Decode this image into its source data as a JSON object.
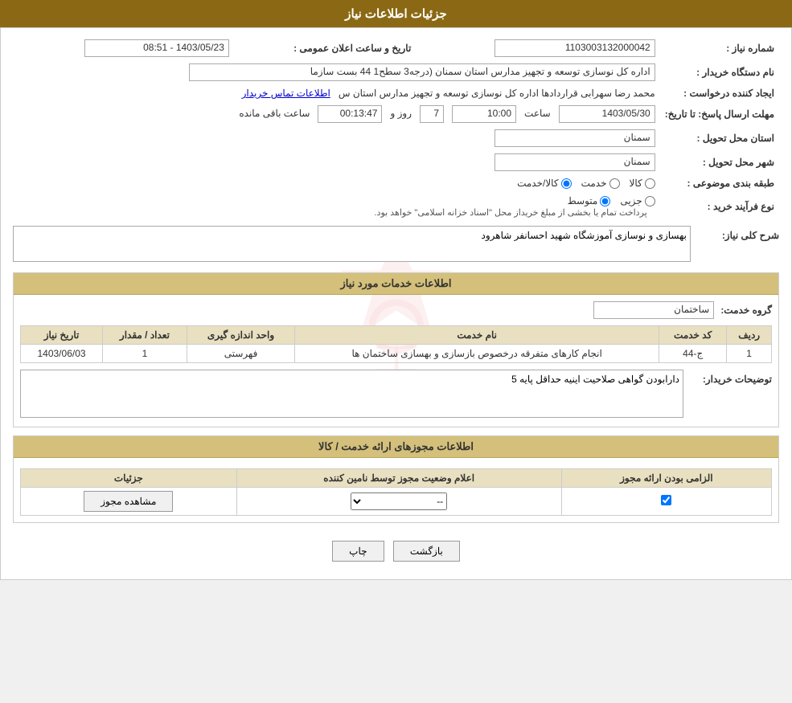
{
  "header": {
    "title": "جزئیات اطلاعات نیاز"
  },
  "main_info": {
    "labels": {
      "need_number": "شماره نیاز :",
      "buyer_name": "نام دستگاه خریدار :",
      "creator": "ایجاد کننده درخواست :",
      "deadline": "مهلت ارسال پاسخ: تا تاریخ:",
      "province": "استان محل تحویل :",
      "city": "شهر محل تحویل :",
      "category": "طبقه بندی موضوعی :",
      "purchase_type": "نوع فرآیند خرید :"
    },
    "need_number": "1103003132000042",
    "announce_label": "تاریخ و ساعت اعلان عمومی :",
    "announce_value": "1403/05/23 - 08:51",
    "buyer_name": "اداره کل نوسازی   توسعه و تجهیز مدارس استان سمنان (درجه3  سطح1  44  بست سازما",
    "creator_name": "محمد رضا سهرابی قراردادها اداره کل نوسازی   توسعه و تجهیز مدارس استان س",
    "creator_link": "اطلاعات تماس خریدار",
    "deadline_date": "1403/05/30",
    "deadline_time": "10:00",
    "deadline_days": "7",
    "deadline_remaining": "00:13:47",
    "deadline_days_label": "روز و",
    "deadline_hours_label": "ساعت",
    "deadline_remaining_label": "ساعت باقی مانده",
    "province_value": "سمنان",
    "city_value": "سمنان",
    "category_options": [
      "کالا",
      "خدمت",
      "کالا/خدمت"
    ],
    "category_selected": "کالا",
    "purchase_type_options": [
      "جزیی",
      "متوسط"
    ],
    "purchase_type_selected": "متوسط",
    "purchase_type_note": "پرداخت تمام یا بخشی از مبلغ خریداز محل \"اسناد خزانه اسلامی\" خواهد بود."
  },
  "need_description": {
    "title": "شرح کلی نیاز:",
    "value": "بهسازی و نوسازی آموزشگاه شهید احسانفر شاهرود"
  },
  "services_info": {
    "title": "اطلاعات خدمات مورد نیاز",
    "group_label": "گروه خدمت:",
    "group_value": "ساختمان",
    "table_headers": {
      "row": "ردیف",
      "service_code": "کد خدمت",
      "service_name": "نام خدمت",
      "unit": "واحد اندازه گیری",
      "quantity": "تعداد / مقدار",
      "date": "تاریخ نیاز"
    },
    "table_rows": [
      {
        "row": "1",
        "service_code": "ج-44",
        "service_name": "انجام کارهای متفرقه درخصوص بازسازی و بهسازی ساختمان ها",
        "unit": "فهرستی",
        "quantity": "1",
        "date": "1403/06/03"
      }
    ],
    "buyer_notes_label": "توضیحات خریدار:",
    "buyer_notes_value": "دارابودن گواهی صلاحیت اینیه حداقل پایه 5"
  },
  "license_info": {
    "title": "اطلاعات مجوزهای ارائه خدمت / کالا",
    "table_headers": {
      "mandatory": "الزامی بودن ارائه مجوز",
      "provider_status": "اعلام وضعیت مجوز توسط نامین کننده",
      "details": "جزئیات"
    },
    "table_rows": [
      {
        "mandatory": true,
        "provider_status": "--",
        "details_label": "مشاهده مجوز"
      }
    ]
  },
  "buttons": {
    "print": "چاپ",
    "back": "بازگشت"
  }
}
